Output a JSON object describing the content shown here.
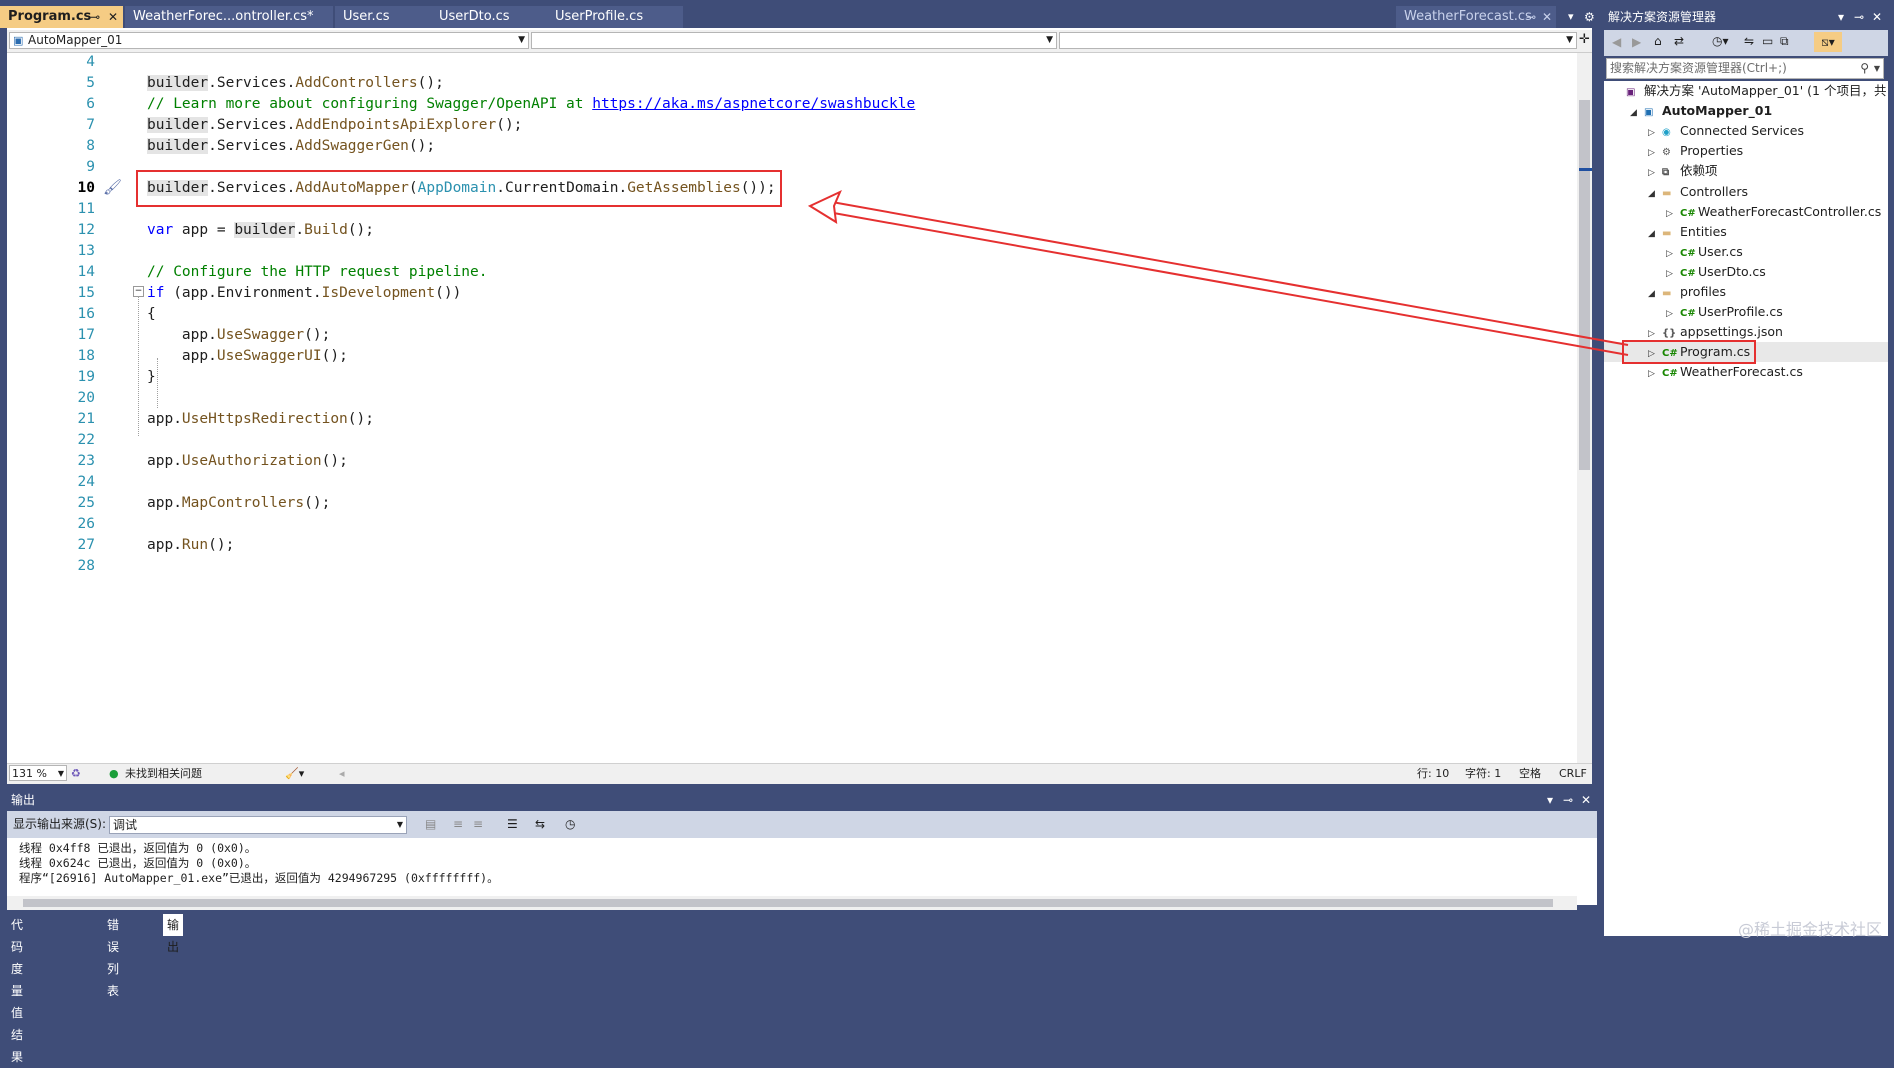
{
  "tabs": [
    {
      "label": "Program.cs",
      "active": true
    },
    {
      "label": "WeatherForec...ontroller.cs*",
      "active": false
    },
    {
      "label": "User.cs",
      "active": false
    },
    {
      "label": "UserDto.cs",
      "active": false
    },
    {
      "label": "UserProfile.cs",
      "active": false
    }
  ],
  "preview_tab": "WeatherForecast.cs",
  "nav": {
    "project": "AutoMapper_01"
  },
  "code_lines": [
    {
      "n": "4",
      "html": ""
    },
    {
      "n": "5",
      "html": "<span class='c-id'>builder</span>.Services.<span class='c-me'>AddControllers</span>();"
    },
    {
      "n": "6",
      "html": "<span class='c-cm'>// Learn more about configuring Swagger/OpenAPI at </span><span class='c-url'>https://aka.ms/aspnetcore/swashbuckle</span>"
    },
    {
      "n": "7",
      "html": "<span class='c-id'>builder</span>.Services.<span class='c-me'>AddEndpointsApiExplorer</span>();"
    },
    {
      "n": "8",
      "html": "<span class='c-id'>builder</span>.Services.<span class='c-me'>AddSwaggerGen</span>();"
    },
    {
      "n": "9",
      "html": ""
    },
    {
      "n": "10",
      "html": "<span class='c-id'>builder</span>.Services.<span class='c-me'>AddAutoMapper</span>(<span class='c-ty'>AppDomain</span>.CurrentDomain.<span class='c-me'>GetAssemblies</span>());"
    },
    {
      "n": "11",
      "html": ""
    },
    {
      "n": "12",
      "html": "<span class='c-kw'>var</span> app = <span class='c-id'>builder</span>.<span class='c-me'>Build</span>();"
    },
    {
      "n": "13",
      "html": ""
    },
    {
      "n": "14",
      "html": "<span class='c-cm'>// Configure the HTTP request pipeline.</span>"
    },
    {
      "n": "15",
      "html": "<span class='c-kw'>if</span> (app.Environment.<span class='c-me'>IsDevelopment</span>())"
    },
    {
      "n": "16",
      "html": "{"
    },
    {
      "n": "17",
      "html": "    app.<span class='c-me'>UseSwagger</span>();"
    },
    {
      "n": "18",
      "html": "    app.<span class='c-me'>UseSwaggerUI</span>();"
    },
    {
      "n": "19",
      "html": "}"
    },
    {
      "n": "20",
      "html": ""
    },
    {
      "n": "21",
      "html": "app.<span class='c-me'>UseHttpsRedirection</span>();"
    },
    {
      "n": "22",
      "html": ""
    },
    {
      "n": "23",
      "html": "app.<span class='c-me'>UseAuthorization</span>();"
    },
    {
      "n": "24",
      "html": ""
    },
    {
      "n": "25",
      "html": "app.<span class='c-me'>MapControllers</span>();"
    },
    {
      "n": "26",
      "html": ""
    },
    {
      "n": "27",
      "html": "app.<span class='c-me'>Run</span>();"
    },
    {
      "n": "28",
      "html": ""
    }
  ],
  "current_line": "10",
  "status": {
    "zoom": "131 %",
    "issues": "未找到相关问题",
    "line": "行: 10",
    "col": "字符: 1",
    "spaces": "空格",
    "eol": "CRLF"
  },
  "output": {
    "title": "输出",
    "source_label": "显示输出来源(S):",
    "source_value": "调试",
    "lines": [
      "线程 0x4ff8 已退出，返回值为 0 (0x0)。",
      "线程 0x624c 已退出，返回值为 0 (0x0)。",
      "程序“[26916] AutoMapper_01.exe”已退出，返回值为 4294967295 (0xffffffff)。"
    ]
  },
  "bottom_tabs": [
    "代码度量值结果",
    "错误列表",
    "输出"
  ],
  "solution_explorer": {
    "title": "解决方案资源管理器",
    "search_placeholder": "搜索解决方案资源管理器(Ctrl+;)",
    "nodes": [
      {
        "label": "解决方案 'AutoMapper_01' (1 个项目，共 1",
        "icon": "solution-icon",
        "depth": 0,
        "exp": ""
      },
      {
        "label": "AutoMapper_01",
        "icon": "project-icon",
        "depth": 1,
        "exp": "open",
        "bold": true
      },
      {
        "label": "Connected Services",
        "icon": "connected-services-icon",
        "depth": 2,
        "exp": "closed"
      },
      {
        "label": "Properties",
        "icon": "properties-icon",
        "depth": 2,
        "exp": "closed"
      },
      {
        "label": "依赖项",
        "icon": "dependencies-icon",
        "depth": 2,
        "exp": "closed"
      },
      {
        "label": "Controllers",
        "icon": "folder-icon",
        "depth": 2,
        "exp": "open"
      },
      {
        "label": "WeatherForecastController.cs",
        "icon": "csharp-file-icon",
        "depth": 3,
        "exp": "closed"
      },
      {
        "label": "Entities",
        "icon": "folder-icon",
        "depth": 2,
        "exp": "open"
      },
      {
        "label": "User.cs",
        "icon": "csharp-file-icon",
        "depth": 3,
        "exp": "closed"
      },
      {
        "label": "UserDto.cs",
        "icon": "csharp-file-icon",
        "depth": 3,
        "exp": "closed"
      },
      {
        "label": "profiles",
        "icon": "folder-icon",
        "depth": 2,
        "exp": "open"
      },
      {
        "label": "UserProfile.cs",
        "icon": "csharp-file-icon",
        "depth": 3,
        "exp": "closed"
      },
      {
        "label": "appsettings.json",
        "icon": "json-file-icon",
        "depth": 2,
        "exp": "closed"
      },
      {
        "label": "Program.cs",
        "icon": "csharp-file-icon",
        "depth": 2,
        "exp": "closed",
        "selected": true
      },
      {
        "label": "WeatherForecast.cs",
        "icon": "csharp-file-icon",
        "depth": 2,
        "exp": "closed"
      }
    ]
  },
  "watermark": "@稀土掘金技术社区",
  "colors": {
    "accent_tab": "#f5cc84",
    "chrome": "#3f4d78",
    "annotation": "#e53030"
  }
}
